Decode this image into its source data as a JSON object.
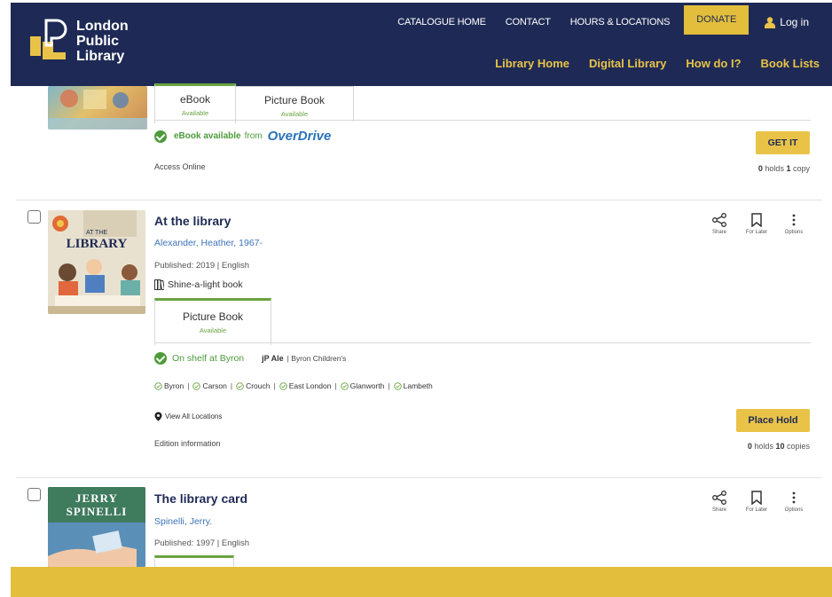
{
  "header": {
    "logo_lines": [
      "London",
      "Public",
      "Library"
    ],
    "utility_links": [
      "CATALOGUE HOME",
      "CONTACT",
      "HOURS & LOCATIONS"
    ],
    "donate_label": "DONATE",
    "login_label": "Log in",
    "main_links": [
      "Library Home",
      "Digital Library",
      "How do I?",
      "Book Lists"
    ]
  },
  "card1": {
    "tabs": [
      {
        "format": "eBook",
        "status": "Available"
      },
      {
        "format": "Picture Book",
        "status": "Available"
      }
    ],
    "availability_bold": "eBook available",
    "availability_from": "from",
    "provider": "OverDrive",
    "access_label": "Access Online",
    "button_label": "GET IT",
    "holds_count": "0",
    "holds_label": "holds",
    "copies_count": "1",
    "copies_label": "copy"
  },
  "card2": {
    "title": "At the library",
    "author": "Alexander, Heather, 1967-",
    "published": "Published: 2019 | English",
    "series": "Shine-a-light book",
    "tab": {
      "format": "Picture Book",
      "status": "Available"
    },
    "shelf_status": "On shelf at Byron",
    "call_number": "jP Ale",
    "collection": "| Byron Children's",
    "branches": [
      "Byron",
      "Carson",
      "Crouch",
      "East London",
      "Glanworth",
      "Lambeth"
    ],
    "view_all": "View All Locations",
    "edition_info": "Edition information",
    "button_label": "Place Hold",
    "holds_count": "0",
    "holds_label": "holds",
    "copies_count": "10",
    "copies_label": "copies",
    "actions": [
      "Share",
      "For Later",
      "Options"
    ],
    "cover_text": [
      "AT THE",
      "LIBRARY"
    ]
  },
  "card3": {
    "title": "The library card",
    "author": "Spinelli, Jerry.",
    "published": "Published: 1997 | English",
    "actions": [
      "Share",
      "For Later",
      "Options"
    ],
    "cover_text": [
      "JERRY",
      "SPINELLI"
    ]
  },
  "colors": {
    "navy": "#1e2a55",
    "gold": "#e9c348",
    "green": "#4d9b3a",
    "link_blue": "#3d73b8"
  }
}
